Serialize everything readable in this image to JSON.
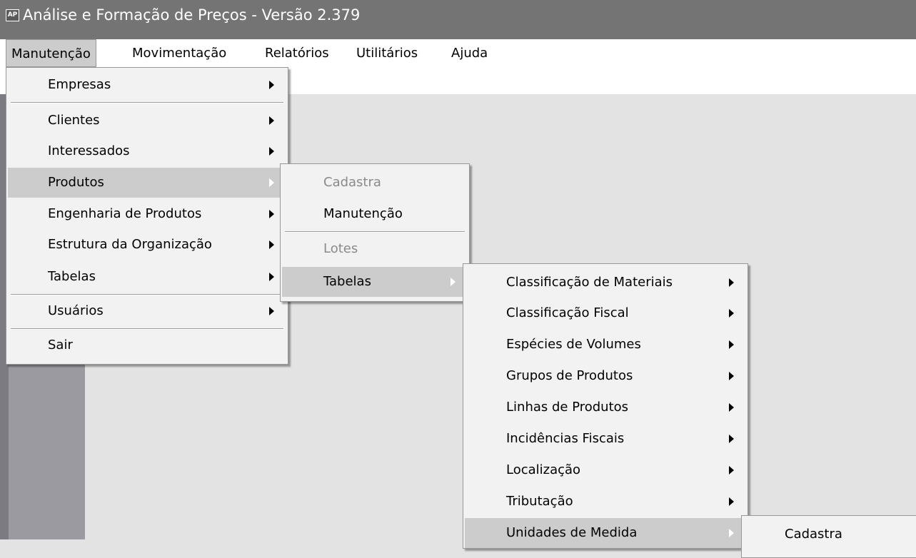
{
  "window": {
    "app_icon_text": "AP",
    "title": "Análise e Formação de Preços - Versão 2.379"
  },
  "menubar": {
    "items": [
      {
        "label": "Manutenção",
        "active": true
      },
      {
        "label": "Movimentação"
      },
      {
        "label": "Relatórios"
      },
      {
        "label": "Utilitários"
      },
      {
        "label": "Ajuda"
      }
    ]
  },
  "manutencao_menu": {
    "items": [
      {
        "label": "Empresas"
      },
      {
        "label": "Clientes"
      },
      {
        "label": "Interessados"
      },
      {
        "label": "Produtos",
        "highlighted": true
      },
      {
        "label": "Engenharia de Produtos"
      },
      {
        "label": "Estrutura da Organização"
      },
      {
        "label": "Tabelas"
      },
      {
        "label": "Usuários"
      },
      {
        "label": "Sair"
      }
    ]
  },
  "produtos_menu": {
    "items": [
      {
        "label": "Cadastra",
        "disabled": true
      },
      {
        "label": "Manutenção"
      },
      {
        "label": "Lotes",
        "disabled": true
      },
      {
        "label": "Tabelas",
        "highlighted": true
      }
    ]
  },
  "tabelas_menu": {
    "items": [
      {
        "label": "Classificação de Materiais"
      },
      {
        "label": "Classificação Fiscal"
      },
      {
        "label": "Espécies de Volumes"
      },
      {
        "label": "Grupos de Produtos"
      },
      {
        "label": "Linhas de Produtos"
      },
      {
        "label": "Incidências Fiscais"
      },
      {
        "label": "Localização"
      },
      {
        "label": "Tributação"
      },
      {
        "label": "Unidades de Medida",
        "highlighted": true
      }
    ]
  },
  "unidades_menu": {
    "items": [
      {
        "label": "Cadastra"
      }
    ]
  }
}
